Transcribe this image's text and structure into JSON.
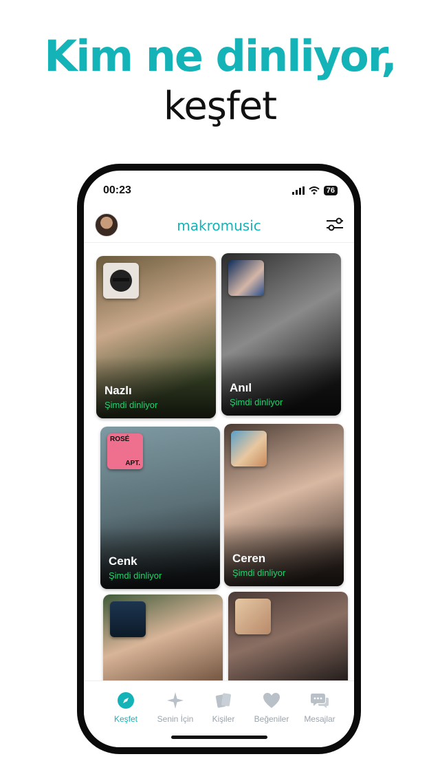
{
  "headline": "Kim ne dinliyor,",
  "subline": "keşfet",
  "status": {
    "time": "00:23",
    "battery": "76"
  },
  "app": {
    "logo": "makromusic"
  },
  "colors": {
    "accent": "#14b3b7",
    "listening": "#22d36e"
  },
  "cards": [
    {
      "name": "Nazlı",
      "status": "Şimdi dinliyor",
      "cover_icon": "album-cover"
    },
    {
      "name": "Anıl",
      "status": "Şimdi dinliyor",
      "cover_icon": "album-cover"
    },
    {
      "name": "Cenk",
      "status": "Şimdi dinliyor",
      "cover_icon": "album-cover",
      "cover_text": "ROSÉ",
      "cover_text2": "APT."
    },
    {
      "name": "Ceren",
      "status": "Şimdi dinliyor",
      "cover_icon": "album-cover"
    },
    {
      "name": "",
      "status": "",
      "cover_icon": "album-cover"
    },
    {
      "name": "",
      "status": "",
      "cover_icon": "album-cover"
    }
  ],
  "tabs": [
    {
      "label": "Keşfet",
      "icon": "compass-icon",
      "active": true
    },
    {
      "label": "Senin İçin",
      "icon": "sparkle-icon",
      "active": false
    },
    {
      "label": "Kişiler",
      "icon": "people-cards-icon",
      "active": false
    },
    {
      "label": "Beğeniler",
      "icon": "heart-icon",
      "active": false
    },
    {
      "label": "Mesajlar",
      "icon": "chat-icon",
      "active": false
    }
  ]
}
